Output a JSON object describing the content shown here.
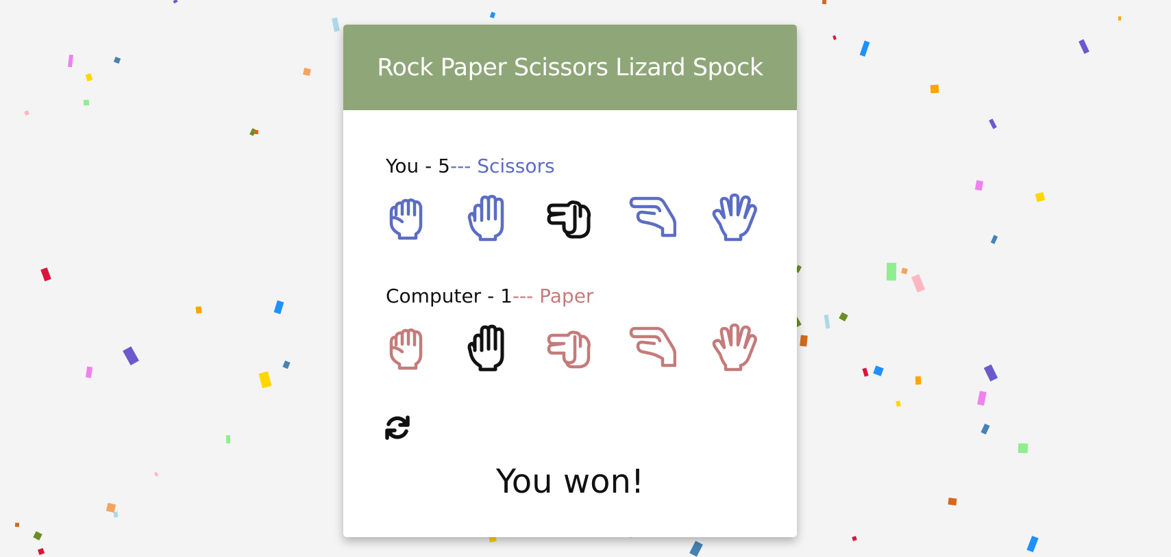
{
  "app": {
    "title": "Rock Paper Scissors Lizard Spock"
  },
  "player": {
    "name": "You",
    "score_prefix": "You - 5",
    "separator": "--- ",
    "choice": "Scissors",
    "color": "#5b6dc3",
    "selected": "scissors"
  },
  "computer": {
    "name": "Computer",
    "score_prefix": "Computer - 1",
    "separator": "--- ",
    "choice": "Paper",
    "color": "#c47b7b",
    "selected": "paper"
  },
  "hands": [
    {
      "key": "rock",
      "icon": "hand-rock-icon"
    },
    {
      "key": "paper",
      "icon": "hand-paper-icon"
    },
    {
      "key": "scissors",
      "icon": "hand-scissors-icon"
    },
    {
      "key": "lizard",
      "icon": "hand-lizard-icon"
    },
    {
      "key": "spock",
      "icon": "hand-spock-icon"
    }
  ],
  "reset": {
    "icon": "refresh-icon"
  },
  "result": {
    "text": "You won!"
  },
  "colors": {
    "header": "#8fa679",
    "selected": "#111111",
    "background": "#f4f4f4"
  }
}
